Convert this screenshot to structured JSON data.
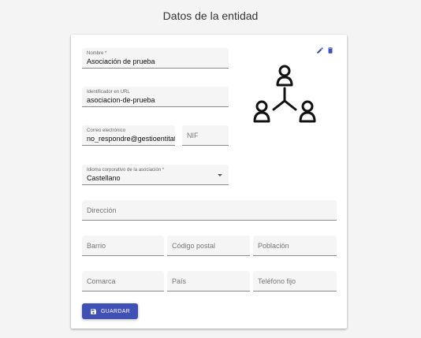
{
  "header": {
    "title": "Datos de la entidad"
  },
  "form": {
    "nombre": {
      "label": "Nombre *",
      "value": "Asociación de prueba"
    },
    "url_id": {
      "label": "Identificador en URL",
      "value": "asociacion-de-prueba"
    },
    "email": {
      "label": "Correo electrónico",
      "value": "no_respondre@gestioentitat"
    },
    "nif": {
      "placeholder": "NIF"
    },
    "idioma": {
      "label": "Idioma corporativo de la asociación *",
      "value": "Castellano"
    },
    "direccion": {
      "placeholder": "Dirección"
    },
    "barrio": {
      "placeholder": "Barrio"
    },
    "codigo_postal": {
      "placeholder": "Código postal"
    },
    "poblacion": {
      "placeholder": "Población"
    },
    "comarca": {
      "placeholder": "Comarca"
    },
    "pais": {
      "placeholder": "País"
    },
    "telefono_fijo": {
      "placeholder": "Teléfono fijo"
    }
  },
  "actions": {
    "save_label": "GUARDAR"
  },
  "icons": {
    "edit": "pencil-icon",
    "delete": "trash-icon",
    "logo": "group-network-icon",
    "save": "floppy-disk-icon"
  },
  "colors": {
    "accent": "#3f51b5",
    "icon": "#3f51b5"
  }
}
